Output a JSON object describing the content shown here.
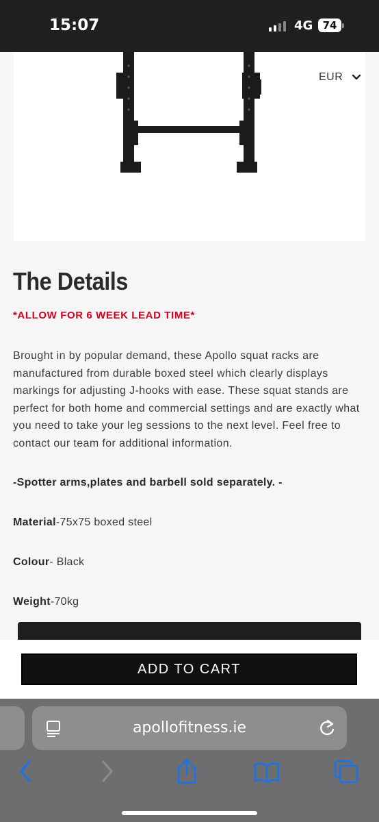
{
  "status": {
    "time": "15:07",
    "network": "4G",
    "battery": "74"
  },
  "currency": {
    "selected": "EUR"
  },
  "details": {
    "title": "The Details",
    "lead_time": "*ALLOW FOR 6 WEEK LEAD TIME*",
    "description": "Brought in by popular demand, these Apollo squat racks are manufactured from durable boxed steel which clearly displays markings for adjusting J-hooks with ease. These squat stands are perfect for both home and commercial settings and are exactly what you need to take your leg sessions to the next level. Feel free to contact our team for additional information.",
    "note": "-Spotter arms,plates and barbell sold separately. -",
    "material_label": "Material",
    "material_value": "-75x75 boxed steel",
    "colour_label": "Colour",
    "colour_value": "- Black",
    "weight_label": "Weight",
    "weight_value": "-70kg"
  },
  "cart": {
    "button_label": "ADD TO CART"
  },
  "browser": {
    "url": "apollofitness.ie"
  },
  "colors": {
    "accent_red": "#d6001c",
    "button_black": "#111111",
    "ios_blue": "#1a73e8"
  }
}
